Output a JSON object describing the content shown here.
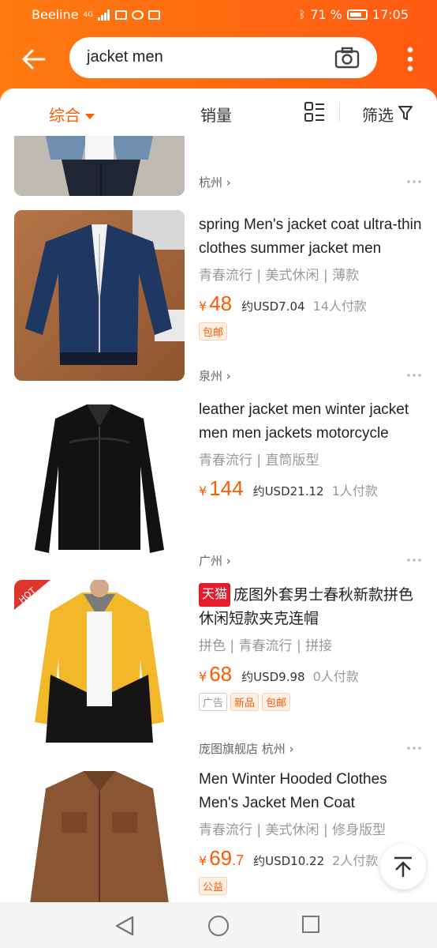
{
  "status_bar": {
    "carrier": "Beeline",
    "network": "4G",
    "battery": "71 %",
    "time": "17:05"
  },
  "search": {
    "query": "jacket men"
  },
  "sort_bar": {
    "tabs": [
      "综合",
      "销量"
    ],
    "filter_label": "筛选"
  },
  "products": [
    {
      "title": "",
      "location": "杭州"
    },
    {
      "title": "spring Men's jacket coat ultra-thin clothes summer jacket men",
      "tags": "青春流行 | 美式休闲 | 薄款",
      "price": "48",
      "usd": "约USD7.04",
      "sold": "14人付款",
      "badges": [
        "包邮"
      ],
      "location": "泉州"
    },
    {
      "title": "leather jacket men winter jacket men men jackets motorcycle",
      "tags": "青春流行 | 直筒版型",
      "price": "144",
      "usd": "约USD21.12",
      "sold": "1人付款",
      "location": "广州"
    },
    {
      "tmall": "天猫",
      "title": "庞图外套男士春秋新款拼色休闲短款夹克连帽",
      "tags": "拼色 | 青春流行 | 拼接",
      "price": "68",
      "usd": "约USD9.98",
      "sold": "0人付款",
      "badges": [
        "广告",
        "新品",
        "包邮"
      ],
      "shop": "庞图旗舰店",
      "location": "杭州"
    },
    {
      "title": "Men Winter Hooded Clothes Men's Jacket Men Coat",
      "tags": "青春流行 | 美式休闲 | 修身版型",
      "price": "69",
      "price_decimal": ".7",
      "usd": "约USD10.22",
      "sold": "2人付款",
      "badges": [
        "公益"
      ]
    }
  ],
  "colors": {
    "accent": "#ff5a00",
    "header": "#ff6a10",
    "tmall": "#e61c2b"
  }
}
